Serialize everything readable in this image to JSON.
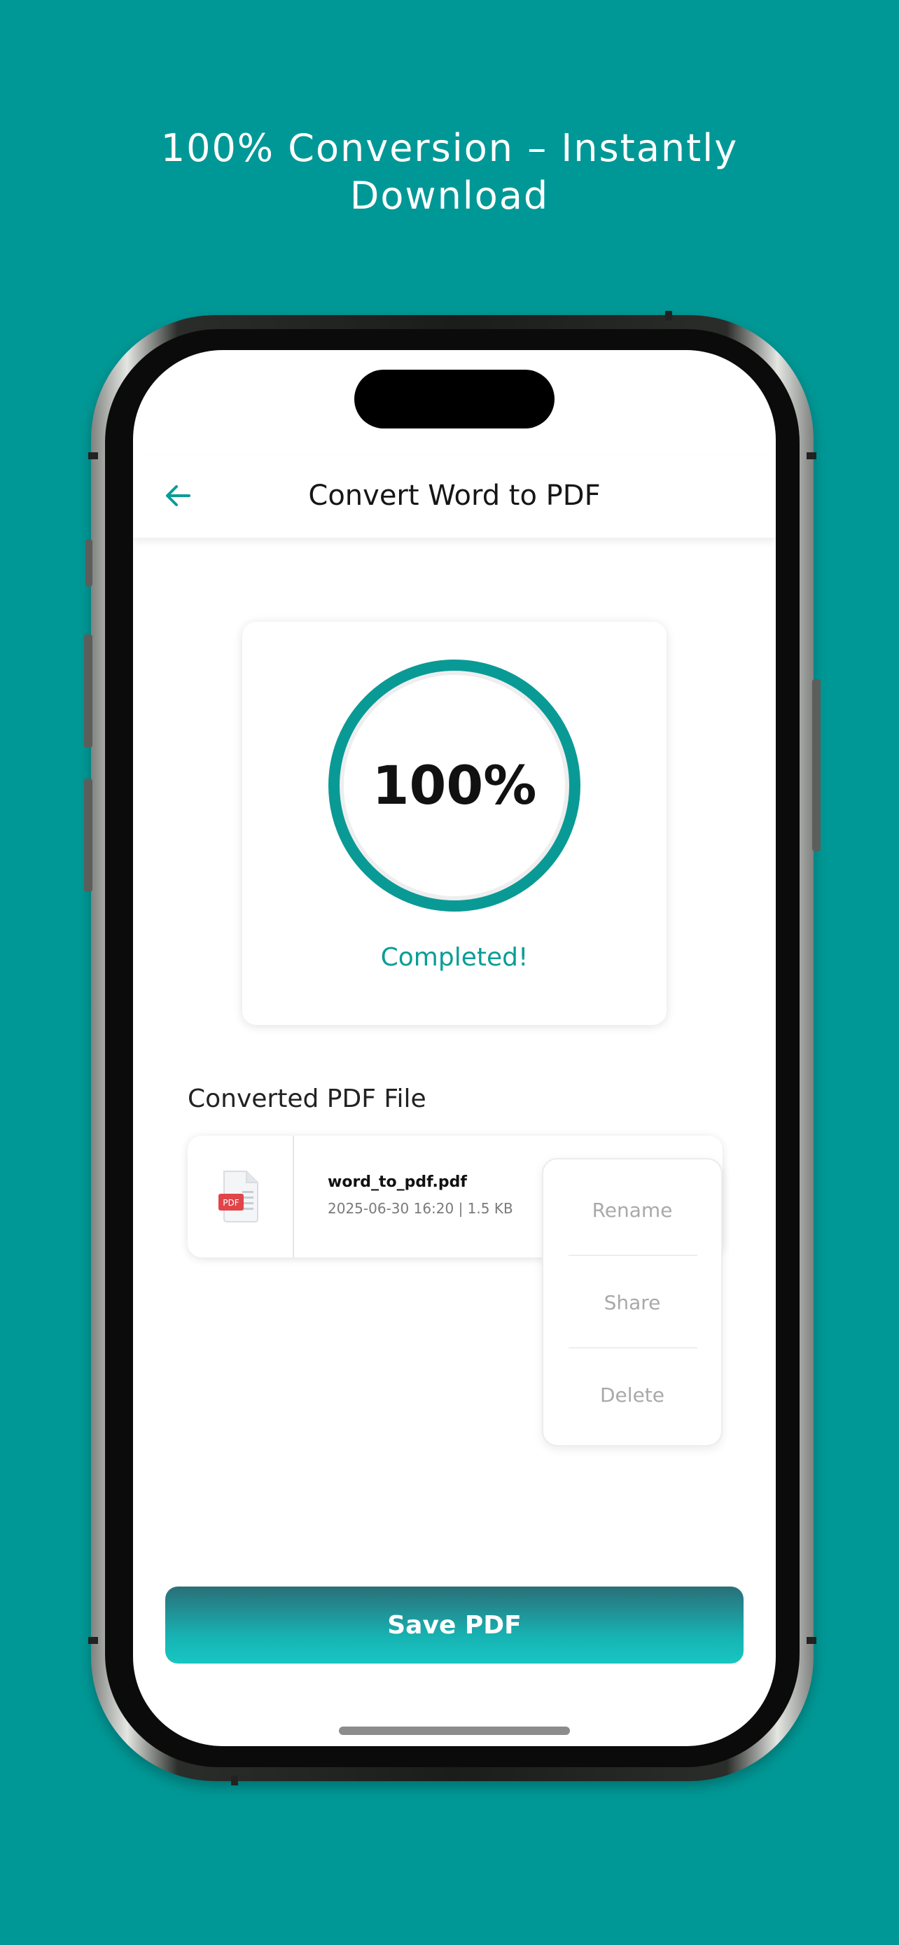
{
  "promo": {
    "headline_line1": "100% Conversion – Instantly",
    "headline_line2": "Download"
  },
  "appbar": {
    "back_icon": "arrow-left-icon",
    "title": "Convert Word to PDF"
  },
  "progress": {
    "percent_label": "100%",
    "value": 1.0,
    "status": "Completed!"
  },
  "section": {
    "title": "Converted PDF File"
  },
  "file": {
    "icon": "pdf-file-icon",
    "name": "word_to_pdf.pdf",
    "meta": "2025-06-30 16:20 | 1.5 KB",
    "badge": "PDF"
  },
  "menu": {
    "items": [
      "Rename",
      "Share",
      "Delete"
    ]
  },
  "save_button": {
    "label": "Save PDF"
  },
  "colors": {
    "background": "#009896",
    "accent": "#0a9d97",
    "pdf_red": "#e0454a"
  }
}
